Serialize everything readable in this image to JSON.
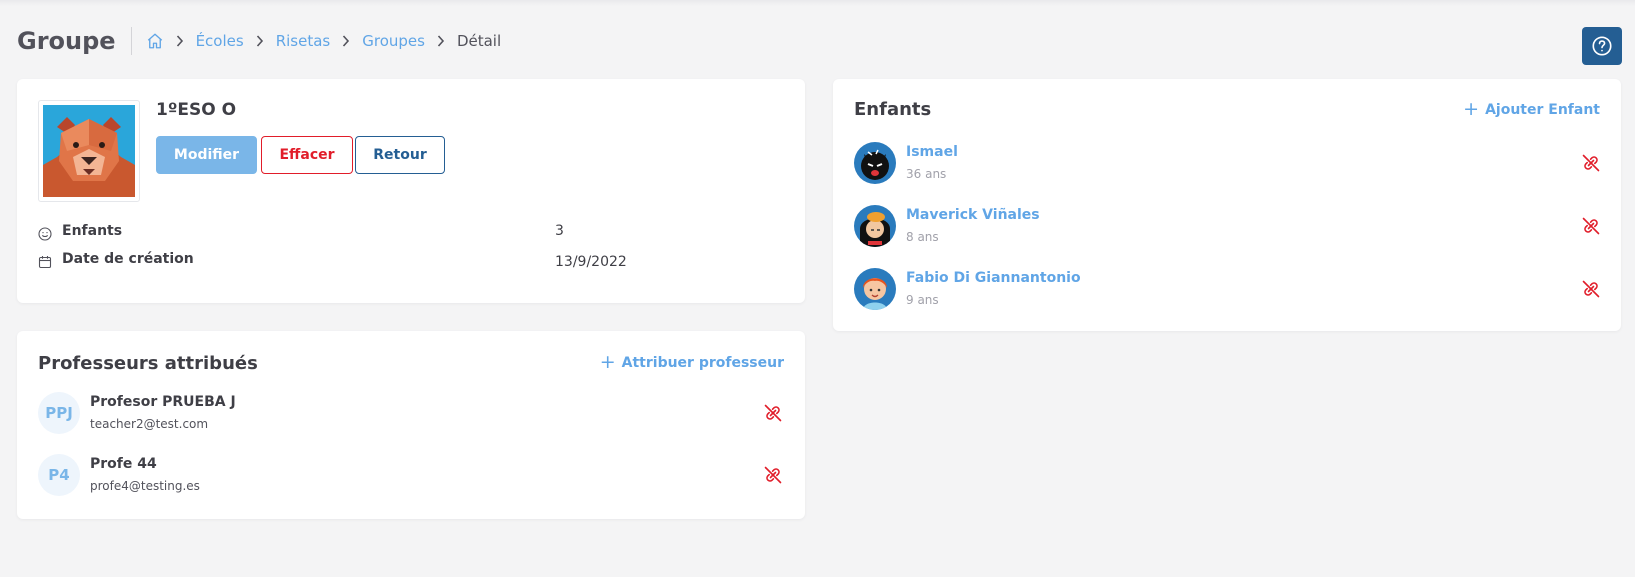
{
  "header": {
    "title": "Groupe",
    "breadcrumb": [
      {
        "label": "Écoles"
      },
      {
        "label": "Risetas"
      },
      {
        "label": "Groupes"
      }
    ],
    "breadcrumb_current": "Détail"
  },
  "group": {
    "name": "1ºESO O",
    "actions": {
      "modify": "Modifier",
      "delete": "Effacer",
      "back": "Retour"
    },
    "info": {
      "children_label": "Enfants",
      "children_value": "3",
      "created_label": "Date de création",
      "created_value": "13/9/2022"
    }
  },
  "teachers": {
    "title": "Professeurs attribués",
    "add_label": "Attribuer professeur",
    "items": [
      {
        "initials": "PPJ",
        "name": "Profesor PRUEBA J",
        "email": "teacher2@test.com"
      },
      {
        "initials": "P4",
        "name": "Profe 44",
        "email": "profe4@testing.es"
      }
    ]
  },
  "children": {
    "title": "Enfants",
    "add_label": "Ajouter Enfant",
    "items": [
      {
        "name": "Ismael",
        "age": "36 ans"
      },
      {
        "name": "Maverick Viñales",
        "age": "8 ans"
      },
      {
        "name": "Fabio Di Giannantonio",
        "age": "9 ans"
      }
    ]
  },
  "colors": {
    "primary": "#245e93",
    "accent": "#60a5e6",
    "danger": "#e11d2a",
    "modify_button": "#7ab6e8"
  },
  "icons": {
    "home": "home-icon",
    "help": "help-circle-icon",
    "smile": "smile-icon",
    "calendar": "calendar-icon",
    "unlink": "unlink-icon",
    "plus": "plus-icon"
  }
}
